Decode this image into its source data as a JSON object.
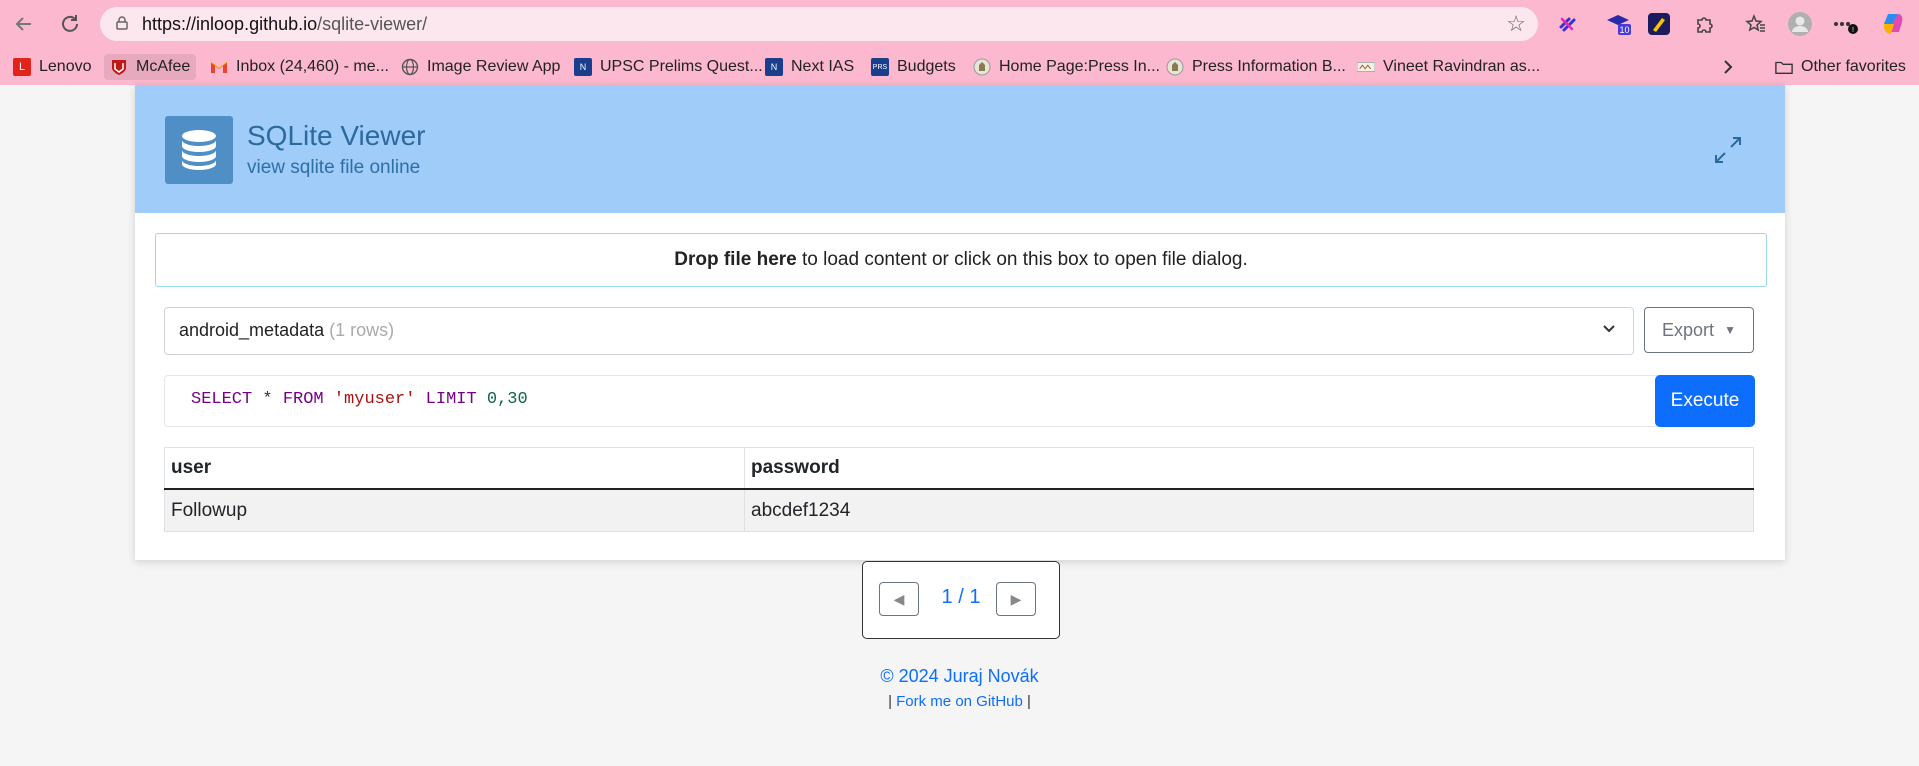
{
  "browser": {
    "url_host": "https://inloop.github.io",
    "url_path": "/sqlite-viewer/",
    "extension_badge": "10"
  },
  "bookmarks": [
    {
      "label": "Lenovo",
      "color": "#e2231a",
      "icon": "L"
    },
    {
      "label": "McAfee",
      "color": "#c01818",
      "icon": "M"
    },
    {
      "label": "Inbox (24,460) - me...",
      "color": "#ea4335",
      "icon": "M"
    },
    {
      "label": "Image Review App",
      "color": "#555555",
      "icon": "globe"
    },
    {
      "label": "UPSC Prelims Quest...",
      "color": "#1a3e8c",
      "icon": "N"
    },
    {
      "label": "Next IAS",
      "color": "#1a3e8c",
      "icon": "N"
    },
    {
      "label": "Budgets",
      "color": "#1a3e8c",
      "icon": "PRS"
    },
    {
      "label": "Home Page:Press In...",
      "color": "#777777",
      "icon": "emblem"
    },
    {
      "label": "Press Information B...",
      "color": "#777777",
      "icon": "emblem"
    },
    {
      "label": "Vineet Ravindran as...",
      "color": "#777777",
      "icon": "logo"
    }
  ],
  "other_favorites": "Other favorites",
  "app": {
    "title": "SQLite Viewer",
    "subtitle": "view sqlite file online"
  },
  "dropzone": {
    "bold": "Drop file here",
    "rest": " to load content or click on this box to open file dialog."
  },
  "table_select": {
    "name": "android_metadata",
    "rows": "(1 rows)"
  },
  "export_label": "Export",
  "query": {
    "kw1": "SELECT",
    "star": " * ",
    "kw2": "FROM",
    "table": "'myuser'",
    "kw3": "LIMIT",
    "limit": "0,30"
  },
  "execute_label": "Execute",
  "results": {
    "headers": [
      "user",
      "password"
    ],
    "rows": [
      [
        "Followup",
        "abcdef1234"
      ]
    ]
  },
  "pager": {
    "text": "1 / 1"
  },
  "footer": {
    "copyright": "© 2024 Juraj Novák",
    "link": "Fork me on GitHub",
    "sep": "|"
  }
}
